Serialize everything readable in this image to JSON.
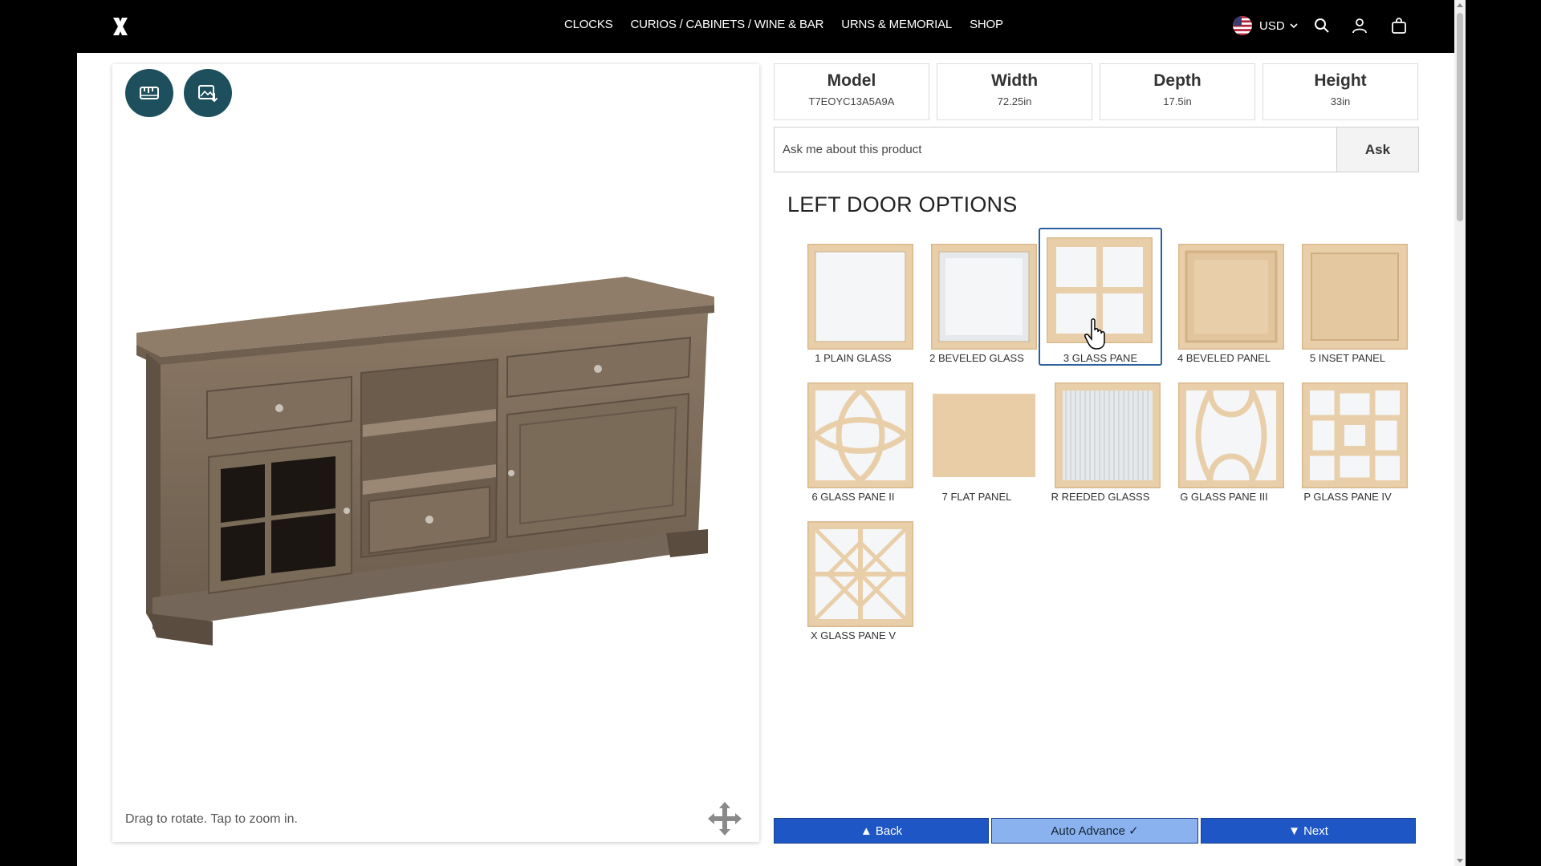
{
  "nav": {
    "links": [
      "CLOCKS",
      "CURIOS / CABINETS / WINE & BAR",
      "URNS & MEMORIAL",
      "SHOP"
    ],
    "currency": "USD"
  },
  "viewer": {
    "hint": "Drag to rotate. Tap to zoom in."
  },
  "specs": [
    {
      "label": "Model",
      "value": "T7EOYC13A5A9A"
    },
    {
      "label": "Width",
      "value": "72.25in"
    },
    {
      "label": "Depth",
      "value": "17.5in"
    },
    {
      "label": "Height",
      "value": "33in"
    }
  ],
  "ask": {
    "placeholder": "Ask me about this product",
    "button": "Ask"
  },
  "section_title": "LEFT DOOR OPTIONS",
  "options": [
    {
      "label": "1 PLAIN GLASS",
      "style": "plain-glass",
      "selected": false
    },
    {
      "label": "2 BEVELED GLASS",
      "style": "beveled-glass",
      "selected": false
    },
    {
      "label": "3 GLASS PANE",
      "style": "glass-pane",
      "selected": true
    },
    {
      "label": "4 BEVELED PANEL",
      "style": "beveled-panel",
      "selected": false
    },
    {
      "label": "5 INSET PANEL",
      "style": "inset-panel",
      "selected": false
    },
    {
      "label": "6 GLASS PANE II",
      "style": "glass-pane-ii",
      "selected": false
    },
    {
      "label": "7 FLAT PANEL",
      "style": "flat-panel",
      "selected": false
    },
    {
      "label": "R REEDED GLASSS",
      "style": "reeded-glass",
      "selected": false
    },
    {
      "label": "G GLASS PANE III",
      "style": "glass-pane-iii",
      "selected": false
    },
    {
      "label": "P GLASS PANE IV",
      "style": "glass-pane-iv",
      "selected": false
    },
    {
      "label": "X GLASS PANE V",
      "style": "glass-pane-v",
      "selected": false
    }
  ],
  "bottom_nav": {
    "back": "▲ Back",
    "auto": "Auto Advance  ✓",
    "next": "▼ Next"
  },
  "colors": {
    "wood": "#e9cfa9",
    "wood_dark": "#d9b88c",
    "glass": "#f4f6f8",
    "accent_button": "#1d4f5c",
    "nav_blue": "#1e56c6"
  }
}
